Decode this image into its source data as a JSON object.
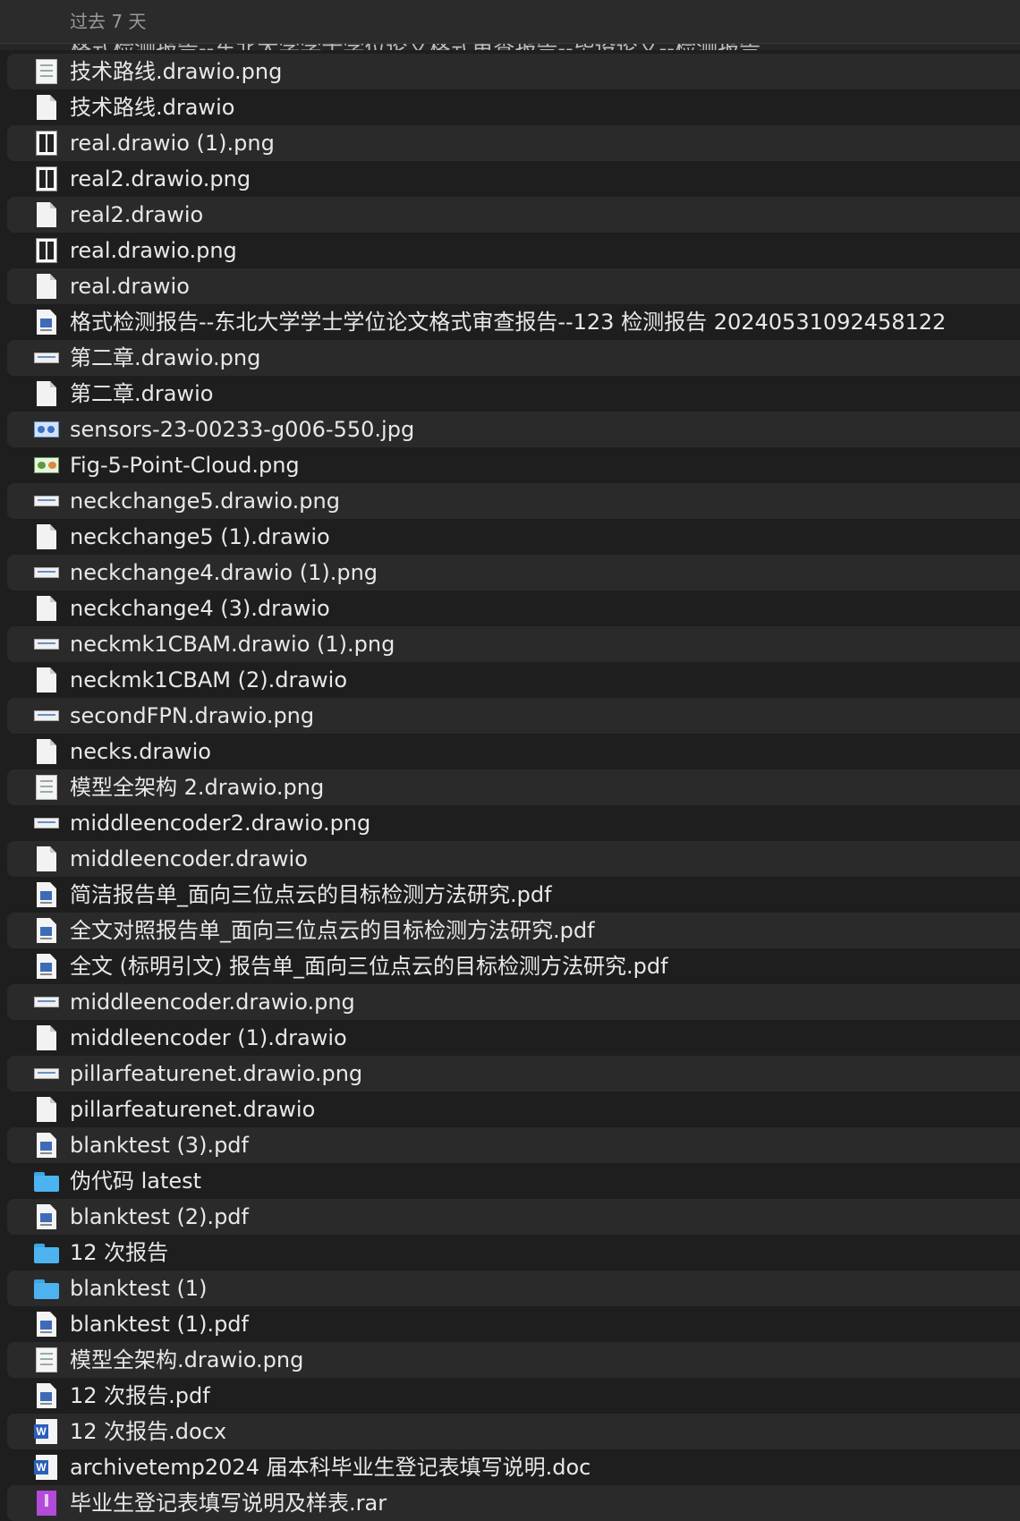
{
  "group_header": "过去 7 天",
  "cut_row": "格式检测报告--东北大学学士学位论文格式审查报告--毕设论文--检测报告",
  "files": [
    {
      "name": "技术路线.drawio.png",
      "icon": "png-icon"
    },
    {
      "name": "技术路线.drawio",
      "icon": "document-icon"
    },
    {
      "name": "real.drawio (1).png",
      "icon": "dark-png-icon"
    },
    {
      "name": "real2.drawio.png",
      "icon": "dark-png-icon"
    },
    {
      "name": "real2.drawio",
      "icon": "document-icon"
    },
    {
      "name": "real.drawio.png",
      "icon": "dark-png-icon"
    },
    {
      "name": "real.drawio",
      "icon": "document-icon"
    },
    {
      "name": "格式检测报告--东北大学学士学位论文格式审查报告--123 检测报告 20240531092458122",
      "icon": "pdf-icon"
    },
    {
      "name": "第二章.drawio.png",
      "icon": "wide-png-icon"
    },
    {
      "name": "第二章.drawio",
      "icon": "document-icon"
    },
    {
      "name": "sensors-23-00233-g006-550.jpg",
      "icon": "image-icon"
    },
    {
      "name": "Fig-5-Point-Cloud.png",
      "icon": "image-green-icon"
    },
    {
      "name": "neckchange5.drawio.png",
      "icon": "wide-png-icon"
    },
    {
      "name": "neckchange5 (1).drawio",
      "icon": "document-icon"
    },
    {
      "name": "neckchange4.drawio (1).png",
      "icon": "wide-png-icon"
    },
    {
      "name": "neckchange4 (3).drawio",
      "icon": "document-icon"
    },
    {
      "name": "neckmk1CBAM.drawio (1).png",
      "icon": "wide-png-icon"
    },
    {
      "name": "neckmk1CBAM (2).drawio",
      "icon": "document-icon"
    },
    {
      "name": "secondFPN.drawio.png",
      "icon": "wide-png-icon"
    },
    {
      "name": "necks.drawio",
      "icon": "document-icon"
    },
    {
      "name": "模型全架构 2.drawio.png",
      "icon": "png-icon"
    },
    {
      "name": "middleencoder2.drawio.png",
      "icon": "wide-png-icon"
    },
    {
      "name": "middleencoder.drawio",
      "icon": "document-icon"
    },
    {
      "name": "简洁报告单_面向三位点云的目标检测方法研究.pdf",
      "icon": "pdf-icon"
    },
    {
      "name": "全文对照报告单_面向三位点云的目标检测方法研究.pdf",
      "icon": "pdf-icon"
    },
    {
      "name": "全文 (标明引文) 报告单_面向三位点云的目标检测方法研究.pdf",
      "icon": "pdf-icon"
    },
    {
      "name": "middleencoder.drawio.png",
      "icon": "wide-png-icon"
    },
    {
      "name": "middleencoder (1).drawio",
      "icon": "document-icon"
    },
    {
      "name": "pillarfeaturenet.drawio.png",
      "icon": "wide-png-icon"
    },
    {
      "name": "pillarfeaturenet.drawio",
      "icon": "document-icon"
    },
    {
      "name": "blanktest (3).pdf",
      "icon": "pdf-icon"
    },
    {
      "name": "伪代码 latest",
      "icon": "folder-icon"
    },
    {
      "name": "blanktest (2).pdf",
      "icon": "pdf-icon"
    },
    {
      "name": "12 次报告",
      "icon": "folder-icon"
    },
    {
      "name": "blanktest (1)",
      "icon": "folder-icon"
    },
    {
      "name": "blanktest (1).pdf",
      "icon": "pdf-icon"
    },
    {
      "name": "模型全架构.drawio.png",
      "icon": "png-icon"
    },
    {
      "name": "12 次报告.pdf",
      "icon": "pdf-icon"
    },
    {
      "name": "12 次报告.docx",
      "icon": "word-icon"
    },
    {
      "name": "archivetemp2024 届本科毕业生登记表填写说明.doc",
      "icon": "word-icon"
    },
    {
      "name": "毕业生登记表填写说明及样表.rar",
      "icon": "rar-icon"
    }
  ]
}
